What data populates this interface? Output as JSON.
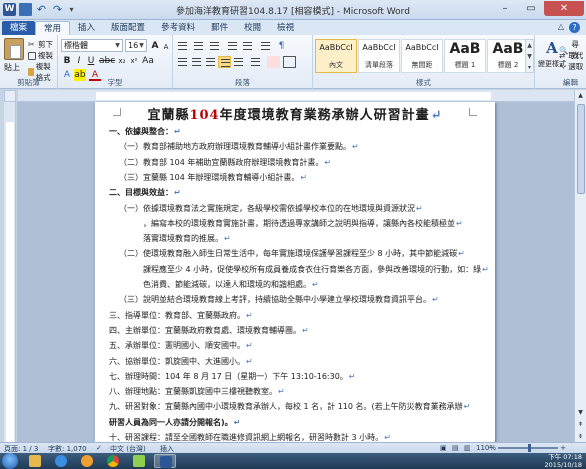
{
  "window": {
    "title": "參加海洋教育研習104.8.17 [相容模式] - Microsoft Word"
  },
  "tabs": [
    "檔案",
    "常用",
    "插入",
    "版面配置",
    "參考資料",
    "郵件",
    "校閱",
    "檢視"
  ],
  "ribbon": {
    "clipboard": {
      "paste": "貼上",
      "cut": "剪下",
      "copy": "複製",
      "format_painter": "複製格式",
      "label": "剪貼簿"
    },
    "font": {
      "name": "標楷體",
      "size": "16",
      "label": "字型"
    },
    "paragraph": {
      "label": "段落"
    },
    "styles": {
      "items": [
        {
          "sample": "AaBbCcI",
          "name": "內文"
        },
        {
          "sample": "AaBbCcI",
          "name": "清單段落"
        },
        {
          "sample": "AaBbCcI",
          "name": "無間距"
        },
        {
          "sample": "AaB",
          "name": "標題 1"
        },
        {
          "sample": "AaB",
          "name": "標題 2"
        }
      ],
      "change_styles": "變更樣式",
      "label": "樣式"
    },
    "editing": {
      "find": "尋找",
      "replace": "取代",
      "select": "選取",
      "label": "編輯"
    }
  },
  "document": {
    "title_prefix": "宜蘭縣",
    "title_year": "104",
    "title_suffix": "年度環境教育業務承辦人研習計畫",
    "lines": [
      {
        "text": "一、依據與整合：",
        "bold": true
      },
      {
        "text": "（一）教育部補助地方政府辦理環境教育輔導小組計畫作業要點。",
        "bold": false
      },
      {
        "text": "（二）教育部 104 年補助宜蘭縣政府辦理環境教育計畫。",
        "bold": false
      },
      {
        "text": "（三）宜蘭縣 104 年辦理環境教育輔導小組計畫。",
        "bold": false
      },
      {
        "text": "二、目標與效益：",
        "bold": true
      },
      {
        "text": "（一）依據環境教育法之實施規定，各級學校需依據學校本位的在地環境與資源狀況",
        "bold": false
      },
      {
        "text": "，編寫本校的環境教育實施計畫，期待透過專家講師之說明與指導，讓縣內各校能積極並",
        "bold": false
      },
      {
        "text": "落實環境教育的推展。",
        "bold": false
      },
      {
        "text": "（二）使環境教育融入師生日常生活中，每年實施環境保護學習課程至少 8 小時，其中節能減碳",
        "bold": false
      },
      {
        "text": "課程應至少 4 小時，促使學校所有成員養成食衣住行育樂各方面，參與改善環境的行動，如：綠",
        "bold": false
      },
      {
        "text": "色消費、節能減碳，以達人和環境的和諧相處。",
        "bold": false
      },
      {
        "text": "（三）說明並結合環境教育線上考評，持續協助全縣中小學建立學校環境教育資訊平台。",
        "bold": false
      },
      {
        "text": "三、指導單位：教育部、宜蘭縣政府。",
        "bold": false
      },
      {
        "text": "四、主辦單位：宜蘭縣政府教育處、環境教育輔導團。",
        "bold": false
      },
      {
        "text": "五、承辦單位：憲明國小、順安國中。",
        "bold": false
      },
      {
        "text": "六、協辦單位：凱旋國中、大進國小。",
        "bold": false
      },
      {
        "text": "七、辦理時間：104 年 8 月 17 日（星期一）下午 13:10-16:30。",
        "bold": false
      },
      {
        "text": "八、辦理地點：宜蘭縣凱旋國中三樓視聽教室。",
        "bold": false
      },
      {
        "text": "九、研習對象：宜蘭縣內國中小環境教育承辦人，每校 1 名，計 110 名。(若上午防災教育業務承辦",
        "bold": false
      },
      {
        "text": "研習人員為同一人亦請分開報名)。",
        "bold": true
      },
      {
        "text": "十、研習課程：請至全國教師在職進修資訊網上網報名，研習時數計 3 小時。",
        "bold": false
      }
    ]
  },
  "statusbar": {
    "page": "頁面: 1 / 3",
    "words": "字數: 1,070",
    "language": "中文 (台灣)",
    "mode": "插入",
    "zoom": "110%"
  },
  "taskbar": {
    "time": "下午 07:18",
    "date": "2015/10/18"
  }
}
